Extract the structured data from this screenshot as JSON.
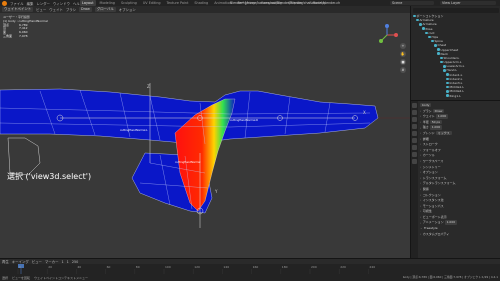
{
  "app": {
    "title": "Blender* [/home/kaeawa/roo/Blender/Blender/chan-Model/blender-chan_v4.4b.blend]",
    "menus": [
      "ファイル",
      "編集",
      "レンダー",
      "ウィンドウ",
      "ヘルプ"
    ],
    "workspace_tabs": [
      "Layout",
      "Modeling",
      "Sculpting",
      "UV Editing",
      "Texture Paint",
      "Shading",
      "Animation",
      "Rendering",
      "Compositing",
      "Scripting",
      "Geometry"
    ],
    "active_tab": "Layout",
    "scene": "Scene",
    "view_layer": "View Layer"
  },
  "viewport_header": {
    "mode": "ウェイトペイント",
    "items": [
      "ビュー",
      "ウェイト",
      "ブラシ"
    ],
    "brush": "Draw",
    "orientation": "グローバル",
    "options": "オプション"
  },
  "stats": {
    "mode_label": "ユーザー・平行投影",
    "object": "(1) body : cuttingHandNormal",
    "rows": [
      {
        "k": "頂点",
        "v": "6,789"
      },
      {
        "k": "辺",
        "v": "7,412"
      },
      {
        "k": "面",
        "v": "6,060"
      },
      {
        "k": "三角面",
        "v": "7,978"
      }
    ]
  },
  "operator_text": "選択 ('view3d.select')",
  "bone_labels": [
    "cuttingHandNormal.L",
    "cuttingHandNormal",
    "cuttingHandNormal.R"
  ],
  "axis_letters": [
    "X",
    "Y",
    "Z"
  ],
  "outliner": {
    "items": [
      {
        "label": "ボーンコレクション",
        "indent": 0
      },
      {
        "label": "Armature",
        "indent": 1
      },
      {
        "label": "Armature",
        "indent": 2
      },
      {
        "label": "Pose",
        "indent": 3
      },
      {
        "label": "root",
        "indent": 4
      },
      {
        "label": "Hips",
        "indent": 5
      },
      {
        "label": "Spine",
        "indent": 6
      },
      {
        "label": "Chest",
        "indent": 7
      },
      {
        "label": "UpperChest",
        "indent": 8
      },
      {
        "label": "Neck",
        "indent": 8
      },
      {
        "label": "Shoulder.L",
        "indent": 9
      },
      {
        "label": "UpperArm.L",
        "indent": 9
      },
      {
        "label": "LowerArm.L",
        "indent": 10
      },
      {
        "label": "Hand.L",
        "indent": 10
      },
      {
        "label": "Index1.L",
        "indent": 11
      },
      {
        "label": "Index2.L",
        "indent": 11
      },
      {
        "label": "Index3.L",
        "indent": 11
      },
      {
        "label": "Middle1.L",
        "indent": 11
      },
      {
        "label": "Middle2.L",
        "indent": 11
      },
      {
        "label": "Ring1.L",
        "indent": 11
      }
    ]
  },
  "properties": {
    "object": "body",
    "rows": [
      {
        "label": "ブラシ",
        "value": "Draw"
      },
      {
        "label": "ウェイト",
        "value": "1.000"
      },
      {
        "label": "半径",
        "value": "50 px"
      },
      {
        "label": "強さ",
        "value": "1.000"
      },
      {
        "label": "ブレンド",
        "value": "ミックス"
      },
      {
        "label": "詳細",
        "value": ""
      },
      {
        "label": "ストローク",
        "value": ""
      },
      {
        "label": "フォールオフ",
        "value": ""
      },
      {
        "label": "カーソル",
        "value": ""
      },
      {
        "label": "ワークスペース",
        "value": ""
      },
      {
        "label": "シンメトリー",
        "value": ""
      },
      {
        "label": "オプション",
        "value": ""
      },
      {
        "label": "トランスフォーム",
        "value": ""
      },
      {
        "label": "デルタトランスフォーム",
        "value": ""
      },
      {
        "label": "関係",
        "value": ""
      },
      {
        "label": "コレクション",
        "value": ""
      },
      {
        "label": "インスタンス化",
        "value": ""
      },
      {
        "label": "モーションパス",
        "value": ""
      },
      {
        "label": "可視性",
        "value": ""
      },
      {
        "label": "ビューポート表示",
        "value": ""
      }
    ],
    "section_anim": "アニメーション",
    "anim_value": "1.000",
    "section_custom": "Freestyle",
    "section_extra": "カスタムプロパティ"
  },
  "timeline": {
    "items": [
      "再生",
      "キーイング",
      "ビュー",
      "マーカー"
    ],
    "current_frame": "1",
    "start": "1",
    "end": "250",
    "ticks": [
      "0",
      "20",
      "40",
      "60",
      "80",
      "100",
      "120",
      "140",
      "160",
      "180",
      "200",
      "220",
      "240"
    ]
  },
  "statusbar": {
    "items": [
      "選択",
      "ビューを回転",
      "ウェイトペイントコンテキストメニュー"
    ],
    "right": "body | 頂点:6,789 | 面:6,060 | 三角面:7,978 | オブジェクト:1/29 | 4.4.1"
  },
  "colors": {
    "mesh_blue": "#0a17c8",
    "wire": "#c8d2ff",
    "viewport_bg": "#393939",
    "accent": "#4772b3"
  }
}
